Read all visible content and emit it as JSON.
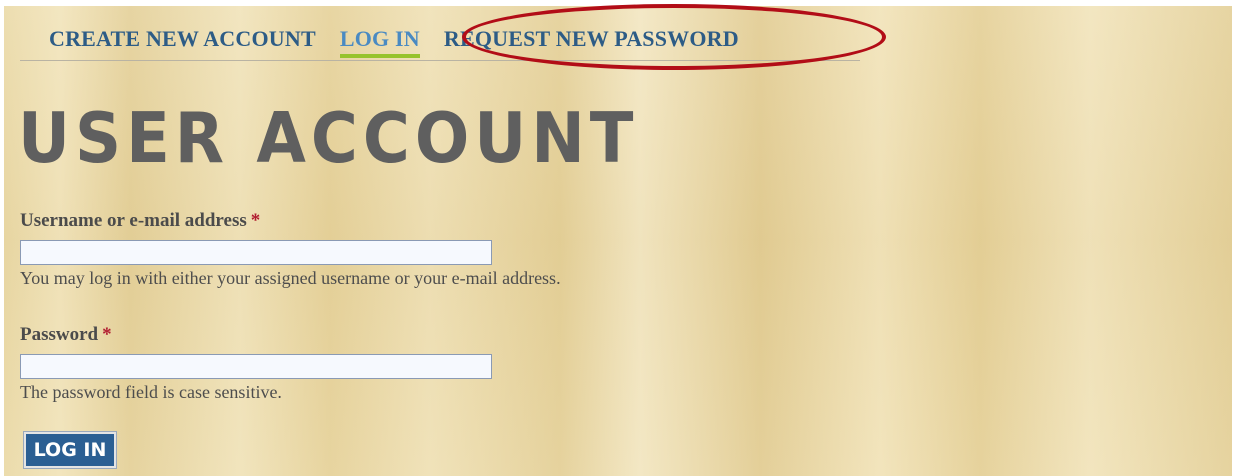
{
  "tabs": [
    {
      "label": "CREATE NEW ACCOUNT",
      "active": false
    },
    {
      "label": "LOG IN",
      "active": true
    },
    {
      "label": "REQUEST NEW PASSWORD",
      "active": false
    }
  ],
  "page_title": "USER ACCOUNT",
  "form": {
    "username": {
      "label": "Username or e-mail address",
      "required_marker": "*",
      "value": "",
      "description": "You may log in with either your assigned username or your e-mail address."
    },
    "password": {
      "label": "Password",
      "required_marker": "*",
      "value": "",
      "description": "The password field is case sensitive."
    },
    "submit_label": "LOG IN"
  },
  "colors": {
    "tab_text": "#2d5c86",
    "tab_active_text": "#4a8ac2",
    "tab_active_underline": "#97c32c",
    "highlight_ellipse": "#b20d17",
    "title_text": "#5f5f5f",
    "required_star": "#b01b2f",
    "button_bg": "#2b5f93"
  }
}
